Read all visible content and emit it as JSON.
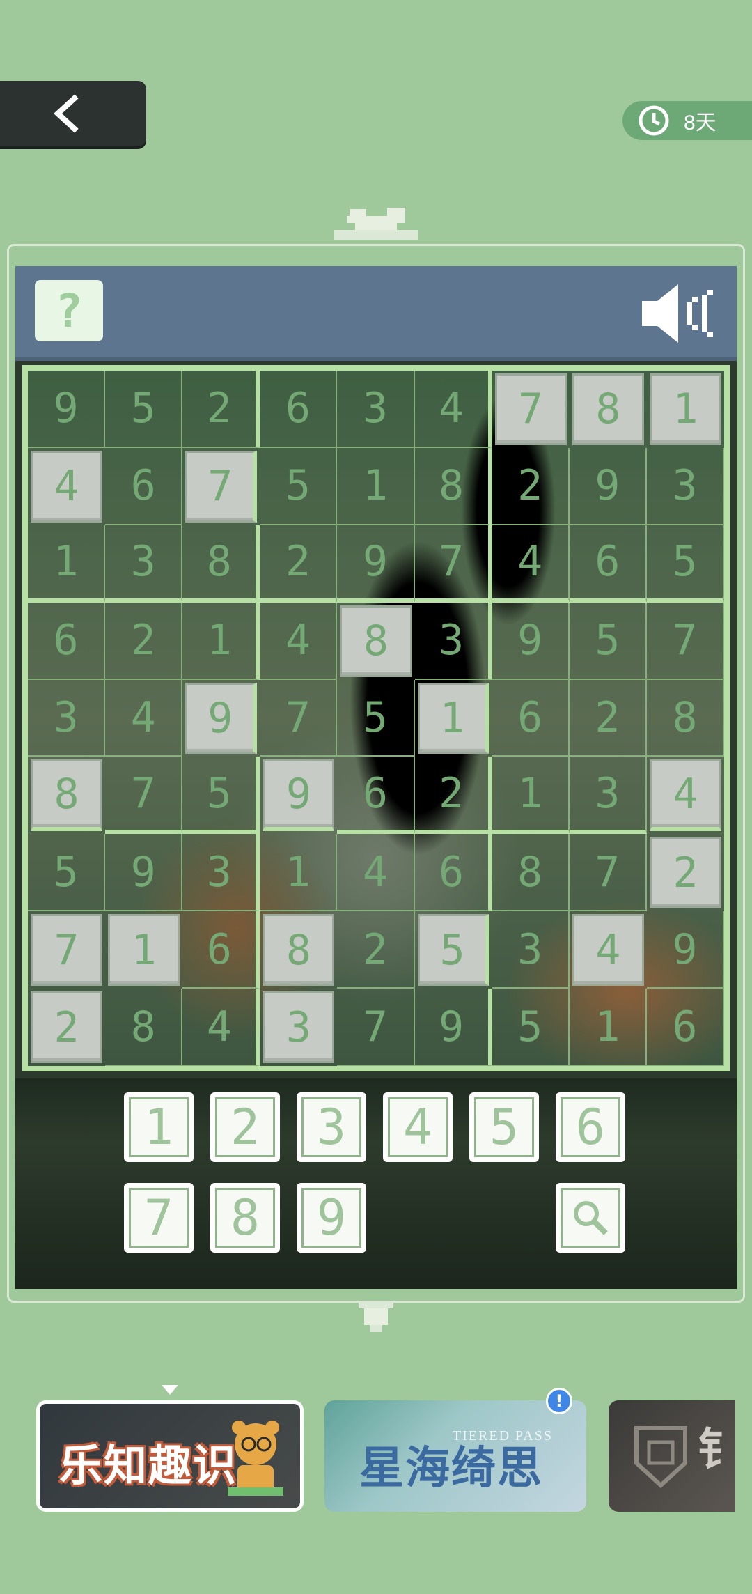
{
  "top_bar": {
    "back_icon": "chevron-left-icon",
    "timer_icon": "clock-icon",
    "timer_text": "8天"
  },
  "toolbar": {
    "help_label": "?",
    "sound_icon": "speaker-icon"
  },
  "board": {
    "rows": [
      [
        9,
        5,
        2,
        6,
        3,
        4,
        7,
        8,
        1
      ],
      [
        4,
        6,
        7,
        5,
        1,
        8,
        2,
        9,
        3
      ],
      [
        1,
        3,
        8,
        2,
        9,
        7,
        4,
        6,
        5
      ],
      [
        6,
        2,
        1,
        4,
        8,
        3,
        9,
        5,
        7
      ],
      [
        3,
        4,
        9,
        7,
        5,
        1,
        6,
        2,
        8
      ],
      [
        8,
        7,
        5,
        9,
        6,
        2,
        1,
        3,
        4
      ],
      [
        5,
        9,
        3,
        1,
        4,
        6,
        8,
        7,
        2
      ],
      [
        7,
        1,
        6,
        8,
        2,
        5,
        3,
        4,
        9
      ],
      [
        2,
        8,
        4,
        3,
        7,
        9,
        5,
        1,
        6
      ]
    ],
    "given": [
      [
        0,
        0,
        0,
        0,
        0,
        0,
        1,
        1,
        1
      ],
      [
        1,
        0,
        1,
        0,
        0,
        0,
        0,
        0,
        0
      ],
      [
        0,
        0,
        0,
        0,
        0,
        0,
        0,
        0,
        0
      ],
      [
        0,
        0,
        0,
        0,
        1,
        0,
        0,
        0,
        0
      ],
      [
        0,
        0,
        1,
        0,
        0,
        1,
        0,
        0,
        0
      ],
      [
        1,
        0,
        0,
        1,
        0,
        0,
        0,
        0,
        1
      ],
      [
        0,
        0,
        0,
        0,
        0,
        0,
        0,
        0,
        1
      ],
      [
        1,
        1,
        0,
        1,
        0,
        1,
        0,
        1,
        0
      ],
      [
        1,
        0,
        0,
        1,
        0,
        0,
        0,
        0,
        0
      ]
    ]
  },
  "number_pad": {
    "keys": [
      "1",
      "2",
      "3",
      "4",
      "5",
      "6",
      "7",
      "8",
      "9"
    ],
    "hint_icon": "magnifier-icon"
  },
  "cards": {
    "card1_title": "乐知趣识",
    "card2_title": "星海绮思",
    "card2_subtitle": "TIERED PASS",
    "card2_alert": "!",
    "card3_glyph": "钅"
  },
  "colors": {
    "background": "#9fc99a",
    "header_band": "#5e7590",
    "board_line": "#b7e0a4",
    "digit": "#74a874"
  }
}
